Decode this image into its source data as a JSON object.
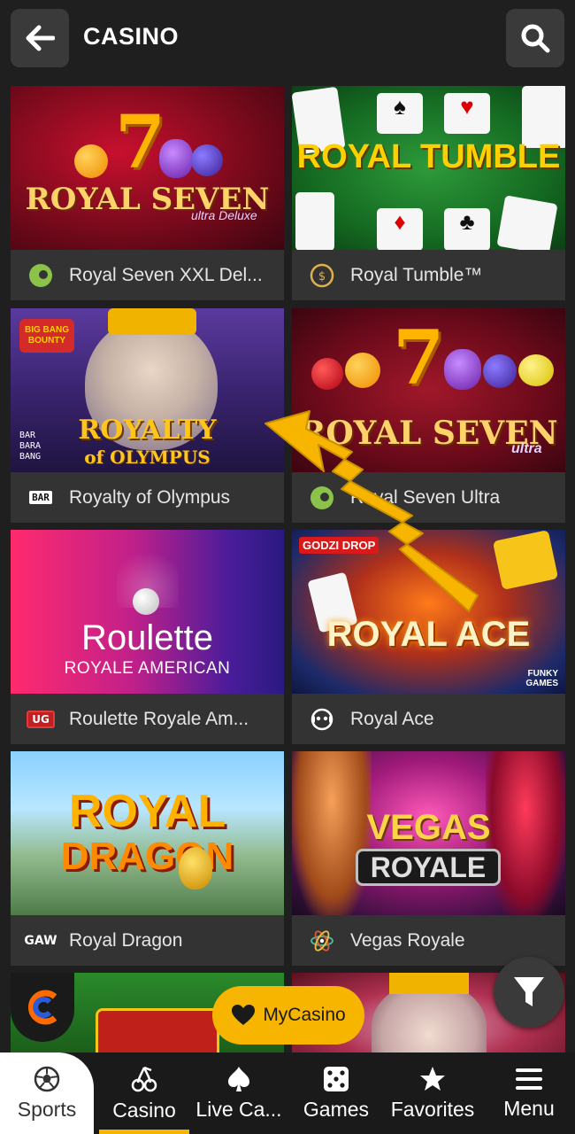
{
  "header": {
    "title": "CASINO"
  },
  "games": [
    {
      "name": "Royal Seven XXL Del...",
      "thumb_title": "ROYAL SEVEN",
      "thumb_sub": "ultra Deluxe",
      "provider": "gamomat"
    },
    {
      "name": "Royal Tumble™",
      "thumb_title": "ROYAL TUMBLE",
      "provider": "gold-coin"
    },
    {
      "name": "Royalty of Olympus",
      "thumb_title": "ROYALTY",
      "thumb_sub": "of OLYMPUS",
      "badge": "BIG BANG BOUNTY",
      "provider": "BAR"
    },
    {
      "name": "Royal Seven Ultra",
      "thumb_title": "ROYAL SEVEN",
      "thumb_sub": "ultra",
      "provider": "gamomat"
    },
    {
      "name": "Roulette Royale Am...",
      "thumb_title": "Roulette",
      "thumb_sub": "ROYALE AMERICAN",
      "provider": "UG"
    },
    {
      "name": "Royal Ace",
      "thumb_title": "ROYAL ACE",
      "badge": "GODZI DROP",
      "badge2": "FUNKY GAMES",
      "provider": "funky"
    },
    {
      "name": "Royal Dragon",
      "thumb_title": "ROYAL",
      "thumb_sub": "DRAGON",
      "provider": "GAW"
    },
    {
      "name": "Vegas Royale",
      "thumb_title": "VEGAS",
      "thumb_sub": "ROYALE",
      "provider": "atom"
    }
  ],
  "floating": {
    "mycasino_label": "MyCasino"
  },
  "nav": {
    "sports": "Sports",
    "casino": "Casino",
    "live": "Live Ca...",
    "games": "Games",
    "favorites": "Favorites",
    "menu": "Menu"
  },
  "colors": {
    "accent": "#f7b500",
    "background": "#1f1f1f",
    "card_footer": "#333333"
  }
}
